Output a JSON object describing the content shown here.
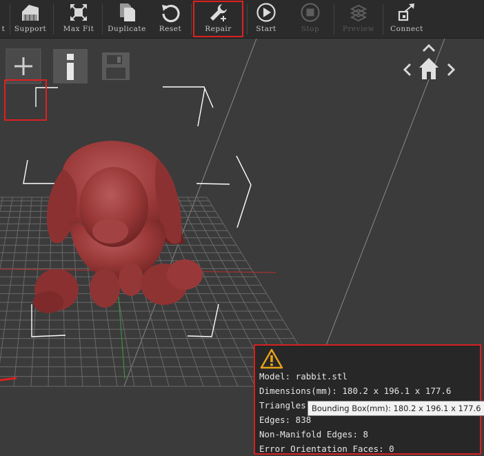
{
  "toolbar": {
    "items": [
      {
        "label": "t",
        "icon": "partial-icon",
        "enabled": true
      },
      {
        "label": "Support",
        "icon": "support-icon",
        "enabled": true
      },
      {
        "label": "Max Fit",
        "icon": "max-fit-icon",
        "enabled": true
      },
      {
        "label": "Duplicate",
        "icon": "duplicate-icon",
        "enabled": true
      },
      {
        "label": "Reset",
        "icon": "reset-icon",
        "enabled": true
      },
      {
        "label": "Repair",
        "icon": "repair-icon",
        "enabled": true,
        "highlighted": true
      },
      {
        "label": "Start",
        "icon": "start-icon",
        "enabled": true
      },
      {
        "label": "Stop",
        "icon": "stop-icon",
        "enabled": false
      },
      {
        "label": "Preview",
        "icon": "preview-icon",
        "enabled": false
      },
      {
        "label": "Connect",
        "icon": "connect-icon",
        "enabled": true
      }
    ]
  },
  "side_tools": {
    "add": {
      "icon": "plus-icon",
      "highlighted": true
    },
    "info": {
      "icon": "info-icon"
    },
    "save": {
      "icon": "save-icon",
      "enabled": false
    }
  },
  "navigation": {
    "icons": [
      "chevron-up-icon",
      "chevron-left-icon",
      "home-icon",
      "chevron-right-icon"
    ]
  },
  "model": {
    "name": "rabbit.stl",
    "color": "#a03a3a"
  },
  "info_panel": {
    "warning_icon": "warning-icon",
    "model_line": "Model: rabbit.stl",
    "dimensions_line": "Dimensions(mm): 180.2 x 196.1 x 177.6",
    "triangles_line": "Triangles",
    "edges_line": "Edges: 838",
    "non_manifold_line": "Non-Manifold Edges: 8",
    "error_faces_line": "Error Orientation Faces: 0"
  },
  "tooltip": {
    "text": "Bounding Box(mm): 180.2 x 196.1 x 177.6"
  },
  "colors": {
    "highlight": "#e02020",
    "accent": "#e8a21a",
    "grid": "#6a6a6a"
  }
}
